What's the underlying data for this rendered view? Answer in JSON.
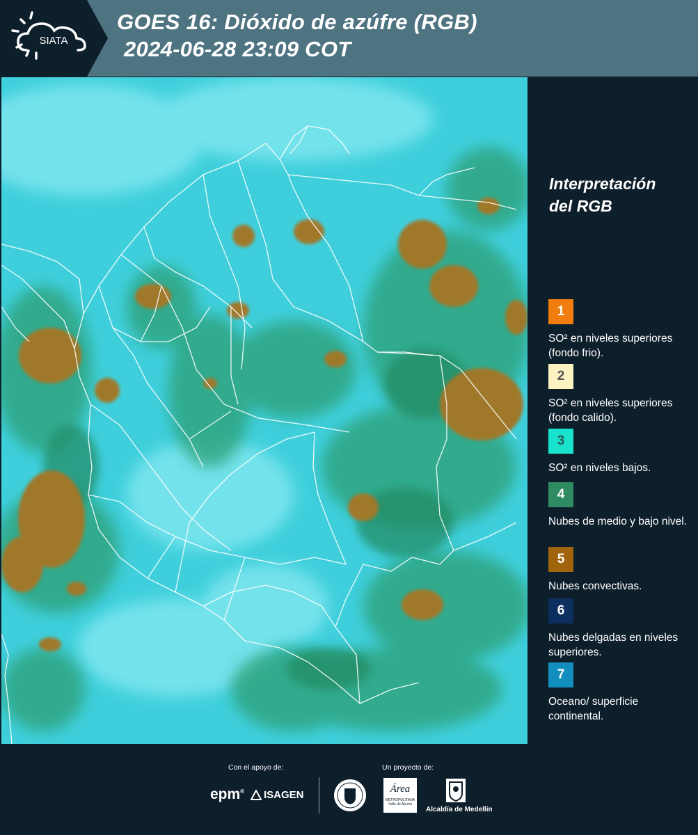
{
  "header": {
    "logo_text": "SIATA",
    "title_line1": "GOES 16: Dióxido de azúfre (RGB)",
    "title_line2": "2024-06-28 23:09 COT"
  },
  "map": {
    "ocean_color": "#3fcfdc",
    "high_cloud_color": "#7ee6ee",
    "mid_low_cloud_color": "#2fa27a",
    "convective_color": "#a0782a",
    "border_color": "#ffffff"
  },
  "legend": {
    "title_line1": "Interpretación",
    "title_line2": "del RGB",
    "items": [
      {
        "number": "1",
        "text": "SO² en niveles superiores (fondo frio).",
        "color": "#f07d0e",
        "text_color": "#ffffff"
      },
      {
        "number": "2",
        "text": "SO² en niveles superiores (fondo calido).",
        "color": "#fdf2c2",
        "text_color": "#555555"
      },
      {
        "number": "3",
        "text": "SO² en niveles bajos.",
        "color": "#19e3cc",
        "text_color": "#2c5a5a"
      },
      {
        "number": "4",
        "text": "Nubes de medio y bajo nivel.",
        "color": "#2e8b62",
        "text_color": "#ffffff"
      },
      {
        "number": "5",
        "text": "Nubes convectivas.",
        "color": "#a0640c",
        "text_color": "#ffffff"
      },
      {
        "number": "6",
        "text": "Nubes delgadas en niveles superiores.",
        "color": "#0d2f5f",
        "text_color": "#ffffff"
      },
      {
        "number": "7",
        "text": "Oceano/ superficie continental.",
        "color": "#138fbf",
        "text_color": "#ffffff"
      }
    ]
  },
  "footer": {
    "support_label": "Con el apoyo de:",
    "project_label": "Un proyecto de:",
    "sponsor_epm": "epm",
    "sponsor_isagen": "ISAGEN",
    "partner_area_line1": "Área",
    "partner_area_line2": "METROPOLITANA",
    "partner_area_line3": "Valle de Aburrá",
    "partner_alcaldia": "Alcaldía de Medellín"
  }
}
